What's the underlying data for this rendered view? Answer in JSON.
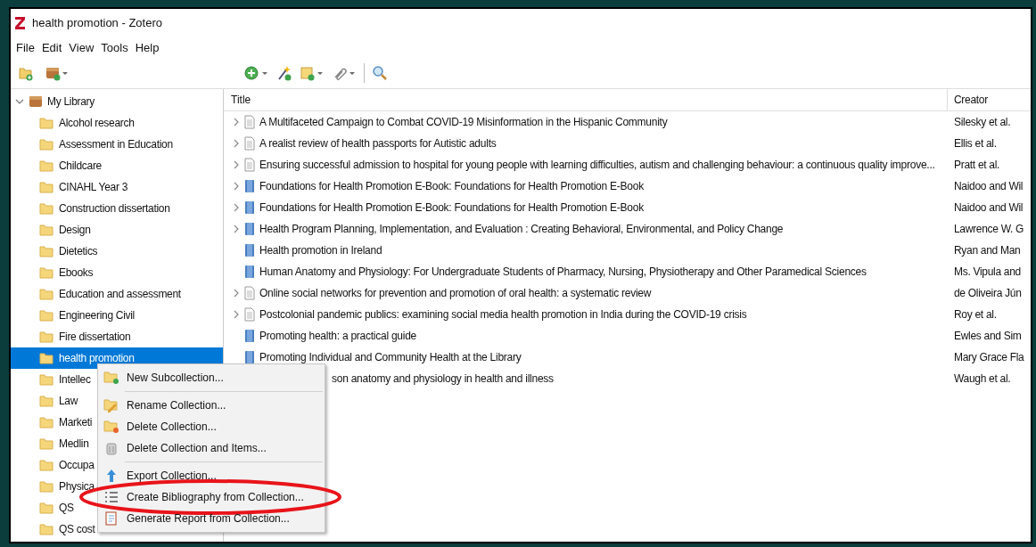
{
  "window": {
    "title": "health promotion - Zotero"
  },
  "menu_bar": [
    "File",
    "Edit",
    "View",
    "Tools",
    "Help"
  ],
  "collections": {
    "root": {
      "label": "My Library",
      "expanded": true
    },
    "items": [
      {
        "label": "Alcohol research",
        "selected": false
      },
      {
        "label": "Assessment in Education",
        "selected": false
      },
      {
        "label": "Childcare",
        "selected": false
      },
      {
        "label": "CINAHL Year 3",
        "selected": false
      },
      {
        "label": "Construction dissertation",
        "selected": false
      },
      {
        "label": "Design",
        "selected": false
      },
      {
        "label": "Dietetics",
        "selected": false
      },
      {
        "label": "Ebooks",
        "selected": false
      },
      {
        "label": "Education and assessment",
        "selected": false
      },
      {
        "label": "Engineering Civil",
        "selected": false
      },
      {
        "label": "Fire dissertation",
        "selected": false
      },
      {
        "label": "health promotion",
        "selected": true
      },
      {
        "label": "Intellec",
        "selected": false
      },
      {
        "label": "Law",
        "selected": false
      },
      {
        "label": "Marketi",
        "selected": false
      },
      {
        "label": "Medlin",
        "selected": false
      },
      {
        "label": "Occupa",
        "selected": false
      },
      {
        "label": "Physica",
        "selected": false
      },
      {
        "label": "QS",
        "selected": false
      },
      {
        "label": "QS cost",
        "selected": false
      }
    ]
  },
  "items_table": {
    "columns": [
      "Title",
      "Creator"
    ],
    "rows": [
      {
        "kind": "document",
        "has_children": true,
        "title": "A Multifaceted Campaign to Combat COVID-19 Misinformation in the Hispanic Community",
        "creator": "Silesky et al."
      },
      {
        "kind": "document",
        "has_children": true,
        "title": "A realist review of health passports for Autistic adults",
        "creator": "Ellis et al."
      },
      {
        "kind": "document",
        "has_children": true,
        "title": "Ensuring successful admission to hospital for young people with learning difficulties, autism and challenging behaviour: a continuous quality improve...",
        "creator": "Pratt et al."
      },
      {
        "kind": "book",
        "has_children": true,
        "title": "Foundations for Health Promotion E-Book: Foundations for Health Promotion E-Book",
        "creator": "Naidoo and Wil"
      },
      {
        "kind": "book",
        "has_children": true,
        "title": "Foundations for Health Promotion E-Book: Foundations for Health Promotion E-Book",
        "creator": "Naidoo and Wil"
      },
      {
        "kind": "book",
        "has_children": true,
        "title": "Health Program Planning, Implementation, and Evaluation : Creating Behavioral, Environmental, and Policy Change",
        "creator": "Lawrence W. G"
      },
      {
        "kind": "book",
        "has_children": false,
        "title": "Health promotion in Ireland",
        "creator": "Ryan and Man"
      },
      {
        "kind": "book",
        "has_children": false,
        "title": "Human Anatomy and Physiology: For Undergraduate Students of Pharmacy, Nursing, Physiotherapy and Other Paramedical Sciences",
        "creator": "Ms. Vipula and"
      },
      {
        "kind": "document",
        "has_children": true,
        "title": "Online social networks for prevention and promotion of oral health: a systematic review",
        "creator": "de Oliveira Jún"
      },
      {
        "kind": "document",
        "has_children": true,
        "title": "Postcolonial pandemic publics: examining social media health promotion in India during the COVID-19 crisis",
        "creator": "Roy et al."
      },
      {
        "kind": "book",
        "has_children": false,
        "title": "Promoting health: a practical guide",
        "creator": "Ewles and Sim"
      },
      {
        "kind": "book",
        "has_children": false,
        "title": "Promoting Individual and Community Health at the Library",
        "creator": "Mary Grace Fla"
      },
      {
        "kind": "covered",
        "has_children": false,
        "title": "son anatomy and physiology in health and illness",
        "creator": "Waugh et al."
      }
    ]
  },
  "context_menu": [
    {
      "kind": "new",
      "label": "New Subcollection...",
      "separator_after": true,
      "highlighted": false
    },
    {
      "kind": "rename",
      "label": "Rename Collection...",
      "separator_after": false,
      "highlighted": false
    },
    {
      "kind": "delete",
      "label": "Delete Collection...",
      "separator_after": false,
      "highlighted": false
    },
    {
      "kind": "delete_items",
      "label": "Delete Collection and Items...",
      "separator_after": true,
      "highlighted": false
    },
    {
      "kind": "export",
      "label": "Export Collection...",
      "separator_after": false,
      "highlighted": false
    },
    {
      "kind": "bibliography",
      "label": "Create Bibliography from Collection...",
      "separator_after": false,
      "highlighted": true
    },
    {
      "kind": "report",
      "label": "Generate Report from Collection...",
      "separator_after": false,
      "highlighted": false
    }
  ]
}
